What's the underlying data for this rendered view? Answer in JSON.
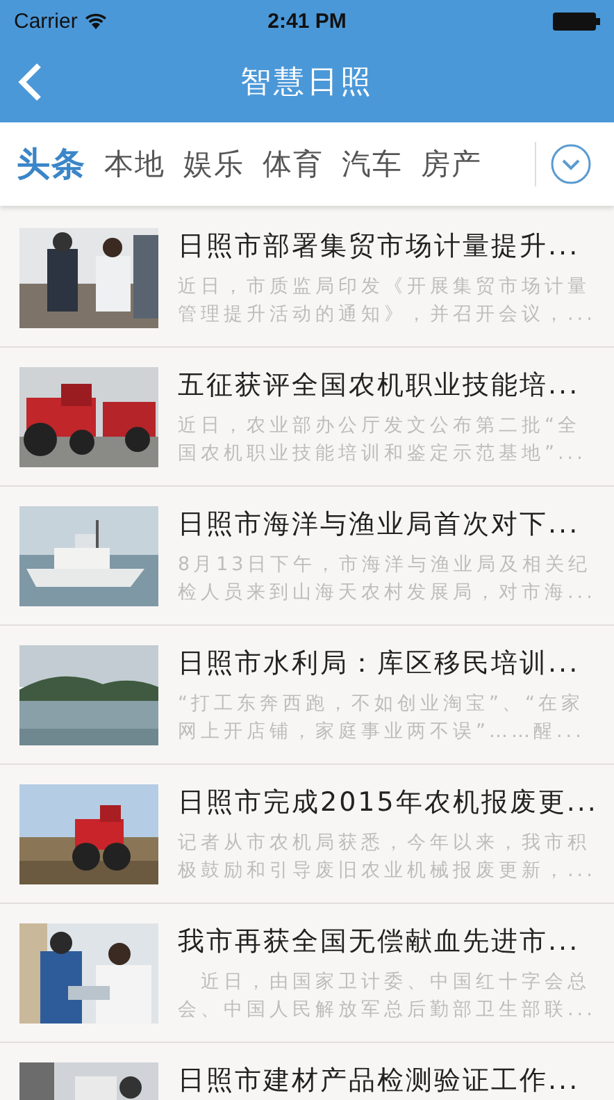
{
  "status_bar": {
    "carrier": "Carrier",
    "time": "2:41 PM"
  },
  "nav_bar": {
    "title": "智慧日照"
  },
  "tabs": [
    {
      "label": "头条",
      "selected": true
    },
    {
      "label": "本地",
      "selected": false
    },
    {
      "label": "娱乐",
      "selected": false
    },
    {
      "label": "体育",
      "selected": false
    },
    {
      "label": "汽车",
      "selected": false
    },
    {
      "label": "房产",
      "selected": false
    }
  ],
  "news": [
    {
      "title": "日照市部署集贸市场计量提升...",
      "summary": "近日，市质监局印发《开展集贸市场计量管理提升活动的通知》，并召开会议，..."
    },
    {
      "title": "五征获评全国农机职业技能培...",
      "summary": "近日，农业部办公厅发文公布第二批“全国农机职业技能培训和鉴定示范基地”..."
    },
    {
      "title": "日照市海洋与渔业局首次对下...",
      "summary": "8月13日下午，市海洋与渔业局及相关纪检人员来到山海天农村发展局，对市海..."
    },
    {
      "title": "日照市水利局：库区移民培训...",
      "summary": "“打工东奔西跑，不如创业淘宝”、“在家网上开店铺，家庭事业两不误”……醒..."
    },
    {
      "title": "日照市完成2015年农机报废更...",
      "summary": "记者从市农机局获悉，今年以来，我市积极鼓励和引导废旧农业机械报废更新，..."
    },
    {
      "title": "我市再获全国无偿献血先进市...",
      "summary": "　近日，由国家卫计委、中国红十字会总会、中国人民解放军总后勤部卫生部联..."
    },
    {
      "title": "日照市建材产品检测验证工作..."
    }
  ]
}
